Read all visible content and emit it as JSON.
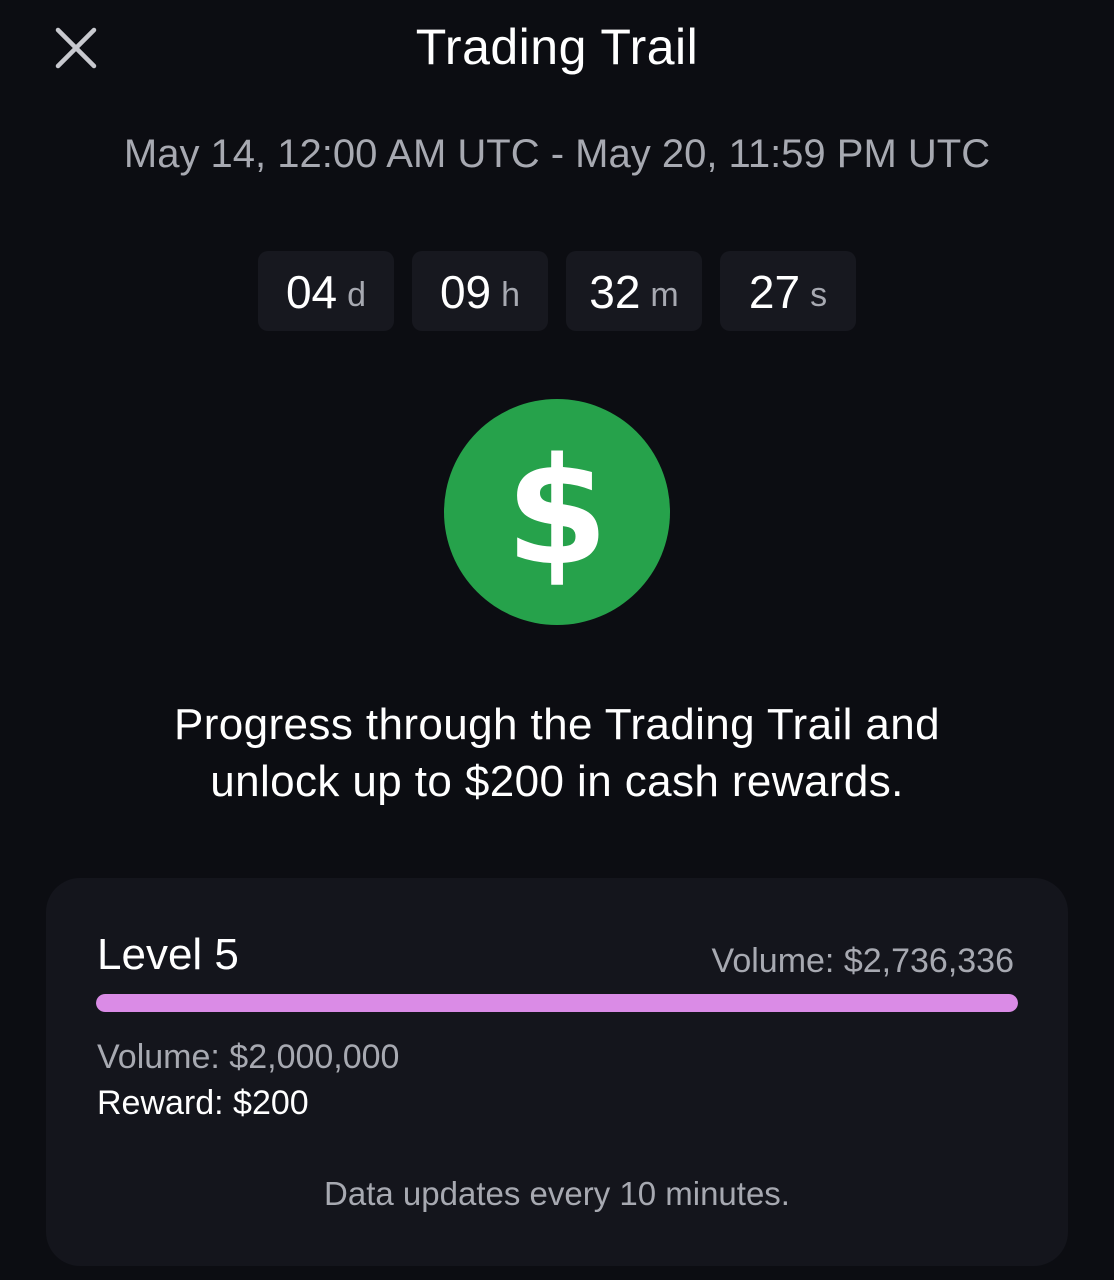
{
  "header": {
    "title": "Trading Trail",
    "close_icon": "close-icon"
  },
  "event": {
    "date_range": "May 14, 12:00 AM UTC - May 20, 11:59 PM UTC"
  },
  "countdown": {
    "days": {
      "value": "04",
      "unit": "d"
    },
    "hours": {
      "value": "09",
      "unit": "h"
    },
    "minutes": {
      "value": "32",
      "unit": "m"
    },
    "seconds": {
      "value": "27",
      "unit": "s"
    }
  },
  "badge": {
    "icon": "dollar-icon",
    "color": "#26a24b"
  },
  "headline": {
    "line1": "Progress through the Trading Trail and",
    "line2": "unlock up to $200 in cash rewards."
  },
  "level_card": {
    "level_label": "Level 5",
    "current_volume": "Volume: $2,736,336",
    "progress_fraction": 1.0,
    "progress_color": "#da8be6",
    "target_volume": "Volume: $2,000,000",
    "reward": "Reward: $200",
    "footnote": "Data updates every 10 minutes."
  }
}
